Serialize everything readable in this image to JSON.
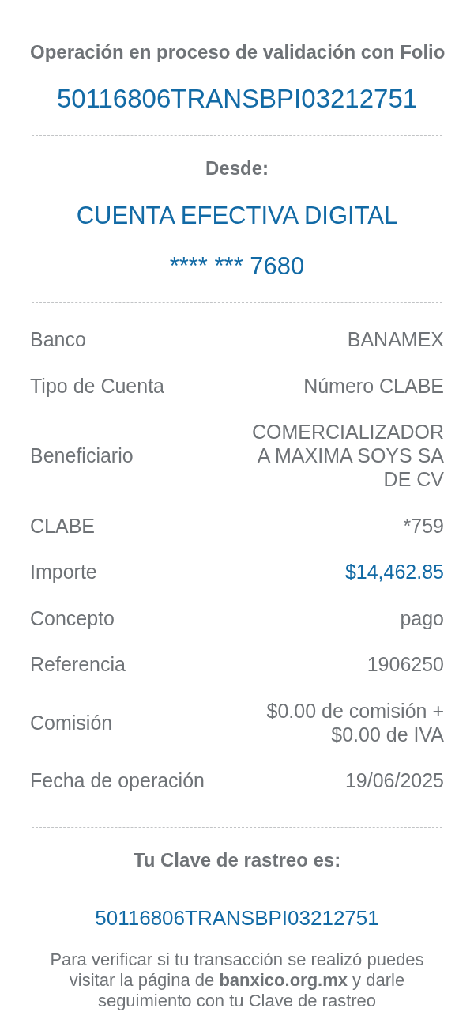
{
  "header": {
    "title": "Operación en proceso de validación con Folio",
    "folio": "50116806TRANSBPI03212751"
  },
  "origin": {
    "label": "Desde:",
    "account_name": "CUENTA EFECTIVA DIGITAL",
    "account_number": "**** *** 7680"
  },
  "details": [
    {
      "label": "Banco",
      "value": "BANAMEX",
      "highlight": false
    },
    {
      "label": "Tipo de Cuenta",
      "value": "Número CLABE",
      "highlight": false
    },
    {
      "label": "Beneficiario",
      "value": "COMERCIALIZADORA MAXIMA SOYS SA DE CV",
      "highlight": false
    },
    {
      "label": "CLABE",
      "value": "*759",
      "highlight": false
    },
    {
      "label": "Importe",
      "value": "$14,462.85",
      "highlight": true
    },
    {
      "label": "Concepto",
      "value": "pago",
      "highlight": false
    },
    {
      "label": "Referencia",
      "value": "1906250",
      "highlight": false
    },
    {
      "label": "Comisión",
      "value": "$0.00 de comisión + $0.00 de IVA",
      "highlight": false
    },
    {
      "label": "Fecha de operación",
      "value": "19/06/2025",
      "highlight": false
    }
  ],
  "tracking": {
    "label": "Tu Clave de rastreo es:",
    "code": "50116806TRANSBPI03212751",
    "note": "Para verificar si tu transacción se realizó puedes visitar la página de **banxico.org.mx** y darle seguimiento con tu Clave de rastreo"
  }
}
